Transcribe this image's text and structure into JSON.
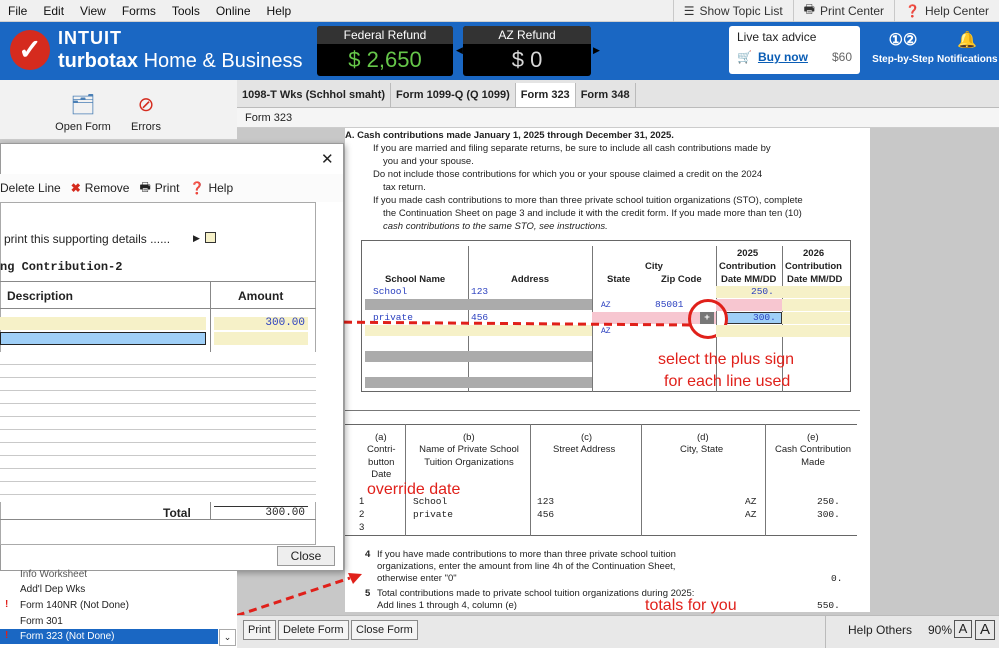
{
  "menu": [
    "File",
    "Edit",
    "View",
    "Forms",
    "Tools",
    "Online",
    "Help"
  ],
  "menu_right": {
    "topic_list": "Show Topic List",
    "print_center": "Print Center",
    "help_center": "Help Center"
  },
  "brand": {
    "intuit": "INTUIT",
    "turbotax": "turbotax",
    "edition": "Home & Business"
  },
  "refunds": {
    "federal_label": "Federal Refund",
    "federal_amount": "2,650",
    "az_label": "AZ Refund",
    "az_amount": "0",
    "currency": "$"
  },
  "live_advice": {
    "title": "Live tax advice",
    "buy": "Buy now",
    "price": "$60"
  },
  "header_tools": {
    "step": "Step-by-Step",
    "notifications": "Notifications"
  },
  "left_tools": {
    "open_form": "Open Form",
    "errors": "Errors"
  },
  "tabs": [
    "1098-T Wks (Schhol smaht)",
    "Form 1099-Q (Q 1099)",
    "Form 323",
    "Form 348"
  ],
  "form_label": "Form 323",
  "form": {
    "section_a": "A.  Cash contributions made January 1, 2025 through December 31, 2025.",
    "bullet1a": "If you are married and filing separate returns, be sure to include all cash contributions made by",
    "bullet1b": "you and your spouse.",
    "bullet2a": "Do not include those contributions for which you or your spouse claimed a credit on the 2024",
    "bullet2b": "tax return.",
    "bullet3a": "If you made cash contributions to more than three private school tuition organizations (STO), complete",
    "bullet3b": "the Continuation Sheet on page 3 and include it with the credit form. If you made more than ten (10)",
    "bullet3c": "cash contributions to the same STO, see instructions.",
    "col_school": "School Name",
    "col_address": "Address",
    "col_city": "City",
    "col_state": "State",
    "col_zip": "Zip Code",
    "col_2025a": "2025",
    "col_2025b": "Contribution",
    "col_2025c": "Date MM/DD",
    "col_2026a": "2026",
    "col_2026b": "Contribution",
    "col_2026c": "Date MM/DD",
    "row1_name": "School",
    "row1_addr": "123",
    "row1_amt": "250.",
    "row2_state": "AZ",
    "row2_zip": "85001",
    "row3_name": "private",
    "row3_addr": "456",
    "row3_amt": "300.",
    "row4_state": "AZ",
    "b_a": "(a)",
    "b_a_lbl": [
      "Contri-",
      "button",
      "Date"
    ],
    "b_b": "(b)",
    "b_b_lbl": [
      "Name of Private School",
      "Tuition Organizations"
    ],
    "b_c": "(c)",
    "b_c_lbl": "Street Address",
    "b_d": "(d)",
    "b_d_lbl": "City, State",
    "b_e": "(e)",
    "b_e_lbl": [
      "Cash Contribution",
      "Made"
    ],
    "line1": "1",
    "line2": "2",
    "line3": "3",
    "l1_name": "School",
    "l1_addr": "123",
    "l1_state": "AZ",
    "l1_amt": "250.",
    "l2_name": "private",
    "l2_addr": "456",
    "l2_state": "AZ",
    "l2_amt": "300.",
    "line4_num": "4",
    "line4a": "If you have made contributions to more than three private school tuition",
    "line4b": "organizations, enter the amount from line 4h of the Continuation Sheet,",
    "line4c": "otherwise enter \"0\"",
    "line4_amt": "0.",
    "line5_num": "5",
    "line5a": "Total contributions made to private school tuition organizations during 2025:",
    "line5b": "Add lines 1 through 4, column (e)",
    "line5_amt": "550."
  },
  "annotations": {
    "plus": "select the plus sign",
    "plus2": "for each line used",
    "override": "override date",
    "totals": "totals for you"
  },
  "dialog": {
    "delete_line": "Delete Line",
    "remove": "Remove",
    "print": "Print",
    "help": "Help",
    "print_details": "print this supporting details ......",
    "title": "ng Contribution-2",
    "col_desc": "Description",
    "col_amt": "Amount",
    "row1_amt": "300.00",
    "total_label": "Total",
    "total_amt": "300.00",
    "close": "Close"
  },
  "left_list": [
    "Info Worksheet",
    "Add'l Dep Wks",
    "Form 140NR (Not Done)",
    "Form 301",
    "Form 323 (Not Done)"
  ],
  "bottom": {
    "print": "Print",
    "delete_form": "Delete Form",
    "close_form": "Close Form",
    "help_others": "Help Others",
    "zoom": "90%"
  }
}
